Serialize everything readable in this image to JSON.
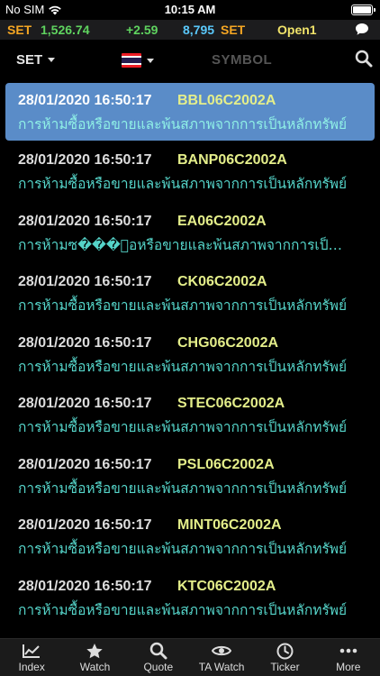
{
  "status": {
    "carrier": "No SIM",
    "time": "10:15 AM",
    "battery_level": 1.0
  },
  "ticker": {
    "market1": "SET",
    "index_value": "1,526.74",
    "change": "+2.59",
    "volume": "8,795",
    "market2": "SET",
    "session": "Open1",
    "chat_icon": "chat-bubble-icon"
  },
  "toolbar": {
    "market_select": "SET",
    "flag_icon": "thailand-flag-icon",
    "symbol_placeholder": "SYMBOL",
    "search_icon": "search-icon"
  },
  "news": [
    {
      "time": "28/01/2020 16:50:17",
      "symbol": "BBL06C2002A",
      "message": "การห้ามซื้อหรือขายและพ้นสภาพจากการเป็นหลักทรัพย์",
      "selected": true
    },
    {
      "time": "28/01/2020 16:50:17",
      "symbol": "BANP06C2002A",
      "message": "การห้ามซื้อหรือขายและพ้นสภาพจากการเป็นหลักทรัพย์",
      "selected": false
    },
    {
      "time": "28/01/2020 16:50:17",
      "symbol": "EA06C2002A",
      "message": "การห้ามซ���้อหรือขายและพ้นสภาพจากการเป็นหลักทรัพย์",
      "selected": false
    },
    {
      "time": "28/01/2020 16:50:17",
      "symbol": "CK06C2002A",
      "message": "การห้ามซื้อหรือขายและพ้นสภาพจากการเป็นหลักทรัพย์",
      "selected": false
    },
    {
      "time": "28/01/2020 16:50:17",
      "symbol": "CHG06C2002A",
      "message": "การห้ามซื้อหรือขายและพ้นสภาพจากการเป็นหลักทรัพย์",
      "selected": false
    },
    {
      "time": "28/01/2020 16:50:17",
      "symbol": "STEC06C2002A",
      "message": "การห้ามซื้อหรือขายและพ้นสภาพจากการเป็นหลักทรัพย์",
      "selected": false
    },
    {
      "time": "28/01/2020 16:50:17",
      "symbol": "PSL06C2002A",
      "message": "การห้ามซื้อหรือขายและพ้นสภาพจากการเป็นหลักทรัพย์",
      "selected": false
    },
    {
      "time": "28/01/2020 16:50:17",
      "symbol": "MINT06C2002A",
      "message": "การห้ามซื้อหรือขายและพ้นสภาพจากการเป็นหลักทรัพย์",
      "selected": false
    },
    {
      "time": "28/01/2020 16:50:17",
      "symbol": "KTC06C2002A",
      "message": "การห้ามซื้อหรือขายและพ้นสภาพจากการเป็นหลักทรัพย์",
      "selected": false
    }
  ],
  "tabs": [
    {
      "label": "Index",
      "icon": "chart-line-icon"
    },
    {
      "label": "Watch",
      "icon": "star-icon"
    },
    {
      "label": "Quote",
      "icon": "search-icon"
    },
    {
      "label": "TA Watch",
      "icon": "eye-icon"
    },
    {
      "label": "Ticker",
      "icon": "clock-icon"
    },
    {
      "label": "More",
      "icon": "more-dots-icon"
    }
  ],
  "colors": {
    "set_label": "#f5a623",
    "positive": "#5fd35f",
    "volume": "#5ac8fa",
    "session": "#f0e36a",
    "symbol": "#e4ee8a",
    "message": "#55d4c9",
    "selected_row": "#5a8cc8"
  }
}
